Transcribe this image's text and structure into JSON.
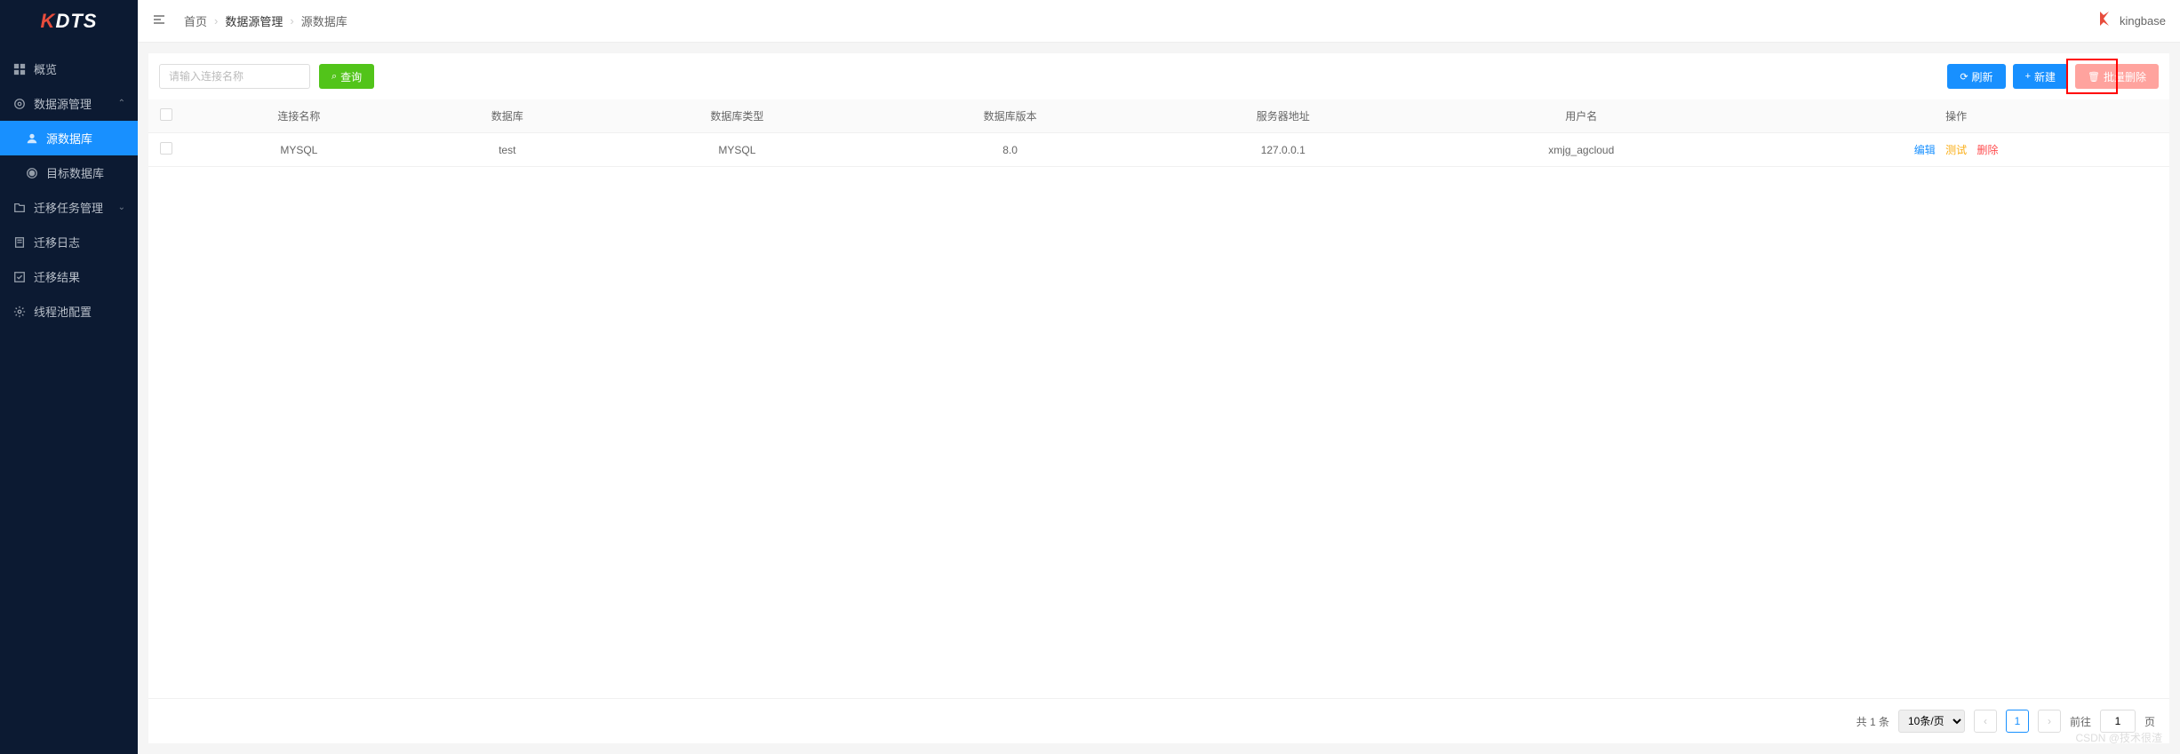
{
  "logo": {
    "k": "K",
    "dts": "DTS"
  },
  "brand": {
    "name": "kingbase"
  },
  "sidebar": {
    "items": [
      {
        "label": "概览",
        "icon": "grid"
      },
      {
        "label": "数据源管理",
        "icon": "datasource",
        "expanded": true
      },
      {
        "label": "源数据库",
        "icon": "user",
        "sub": true,
        "active": true
      },
      {
        "label": "目标数据库",
        "icon": "target",
        "sub": true
      },
      {
        "label": "迁移任务管理",
        "icon": "folder",
        "collapsed": true
      },
      {
        "label": "迁移日志",
        "icon": "log"
      },
      {
        "label": "迁移结果",
        "icon": "result"
      },
      {
        "label": "线程池配置",
        "icon": "settings"
      }
    ]
  },
  "breadcrumb": {
    "items": [
      "首页",
      "数据源管理",
      "源数据库"
    ]
  },
  "toolbar": {
    "search_placeholder": "请输入连接名称",
    "query_label": "查询",
    "refresh_label": "刷新",
    "new_label": "新建",
    "batch_delete_label": "批量删除"
  },
  "table": {
    "headers": [
      "连接名称",
      "数据库",
      "数据库类型",
      "数据库版本",
      "服务器地址",
      "用户名",
      "操作"
    ],
    "rows": [
      {
        "conn_name": "MYSQL",
        "database": "test",
        "db_type": "MYSQL",
        "db_version": "8.0",
        "server": "127.0.0.1",
        "username": "xmjg_agcloud"
      }
    ],
    "actions": {
      "edit": "编辑",
      "test": "测试",
      "delete": "删除"
    }
  },
  "pagination": {
    "total_text": "共 1 条",
    "page_size_text": "10条/页",
    "current": "1",
    "goto_label": "前往",
    "page_label": "页"
  },
  "watermark": "CSDN @技术很渣"
}
